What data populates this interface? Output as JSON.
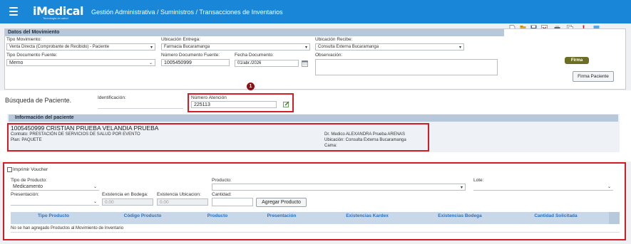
{
  "header": {
    "logo": "iMedical",
    "logo_sub": "Tecnología en salud",
    "breadcrumb": "Gestión Administrativa  /  Suministros  /  Transacciones de Inventarios"
  },
  "movimiento": {
    "title": "Datos del Movimiento",
    "tipo_movimiento_label": "Tipo Movimiento:",
    "tipo_movimiento_value": "Venta Directa (Comprobante de Recibido) - Paciente",
    "ubicacion_entrega_label": "Ubicación Entrega:",
    "ubicacion_entrega_value": "Farmacia Bucaramanga",
    "ubicacion_recibe_label": "Ubicación Recibe:",
    "ubicacion_recibe_value": "Consulta Externa Bucaramanga",
    "tipo_doc_label": "Tipo Documento Fuente:",
    "tipo_doc_value": "Memo",
    "numero_doc_label": "Número Documento Fuente:",
    "numero_doc_value": "1005450999",
    "fecha_doc_label": "Fecha Documento:",
    "fecha_doc_value": "01/abr./2026",
    "observacion_label": "Observación:",
    "firma_badge": "Firma",
    "firma_button": "Firma Paciente"
  },
  "busqueda": {
    "title": "Búsqueda de Paciente.",
    "identificacion_label": "Identificación:",
    "numero_atencion_label": "Número Atención",
    "numero_atencion_value": "225113",
    "marker": "1"
  },
  "paciente": {
    "title": "Información del paciente",
    "name": "1005450999 CRISTIAN PRUEBA VELANDIA PRUEBA",
    "contrato": "Contrato: PRESTACIÓN DE SERVICIOS DE SALUD POR EVENTO",
    "plan": "Plan: PAQUETE",
    "medico": "Dr. Medico ALEXANDRA Prueba ARENAS",
    "ubicacion": "Ubicación: Consulta Externa Bucaramanga",
    "cama": "Cama:"
  },
  "productos": {
    "imprimir_voucher": "Imprimir Voucher",
    "tipo_producto_label": "Tipo de Producto:",
    "tipo_producto_value": "Medicamento",
    "producto_label": "Producto:",
    "lote_label": "Lote:",
    "presentacion_label": "Presentación:",
    "exist_bodega_label": "Existencia en Bodega:",
    "exist_bodega_value": "0.00",
    "exist_ubicacion_label": "Existencia Ubicacion:",
    "exist_ubicacion_value": "0.00",
    "cantidad_label": "Cantidad:",
    "agregar_button": "Agregar Producto",
    "columns": [
      "Tipo Producto",
      "Código Producto",
      "Producto",
      "Presentación",
      "Existencias Kardex",
      "Existencias Bodega",
      "Cantidad Solicitada"
    ],
    "empty_message": "No se han agregado Productos al Movimiento de Inventario"
  },
  "colors": {
    "header_blue": "#1a86d8",
    "highlight_red": "#d51c24",
    "section_head": "#b7c8da"
  }
}
